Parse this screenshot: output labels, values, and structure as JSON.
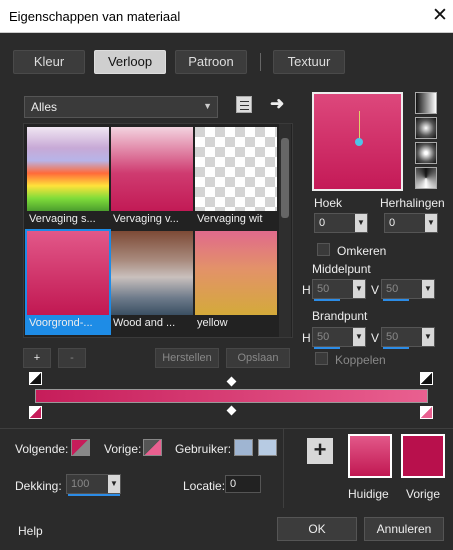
{
  "dialog": {
    "title": "Eigenschappen van materiaal",
    "close": "✕"
  },
  "tabs": [
    {
      "label": "Kleur"
    },
    {
      "label": "Verloop"
    },
    {
      "label": "Patroon"
    },
    {
      "label": "Textuur"
    }
  ],
  "category": {
    "value": "Alles"
  },
  "gallery": {
    "items": [
      {
        "label": "Vervaging s..."
      },
      {
        "label": "Vervaging v..."
      },
      {
        "label": "Vervaging wit"
      },
      {
        "label": "Voorgrond-..."
      },
      {
        "label": "Wood and ..."
      },
      {
        "label": "yellow"
      }
    ]
  },
  "stop_buttons": {
    "add": "+",
    "remove": "-",
    "reset": "Herstellen",
    "save": "Opslaan"
  },
  "angle": {
    "label": "Hoek",
    "value": "0"
  },
  "repeats": {
    "label": "Herhalingen",
    "value": "0"
  },
  "invert": {
    "label": "Omkeren"
  },
  "center": {
    "label": "Middelpunt",
    "h_label": "H",
    "h": "50",
    "v_label": "V",
    "v": "50"
  },
  "focus": {
    "label": "Brandpunt",
    "h_label": "H",
    "h": "50",
    "v_label": "V",
    "v": "50"
  },
  "link": {
    "label": "Koppelen"
  },
  "stops": {
    "next_label": "Volgende:",
    "prev_label": "Vorige:",
    "user_label": "Gebruiker:",
    "opacity_label": "Dekking:",
    "opacity": "100",
    "location_label": "Locatie:",
    "location": "0"
  },
  "swatches": {
    "current_label": "Huidige",
    "previous_label": "Vorige",
    "current_color": "#d63c74",
    "previous_color": "#b8104c"
  },
  "footer": {
    "help": "Help",
    "ok": "OK",
    "cancel": "Annuleren"
  }
}
